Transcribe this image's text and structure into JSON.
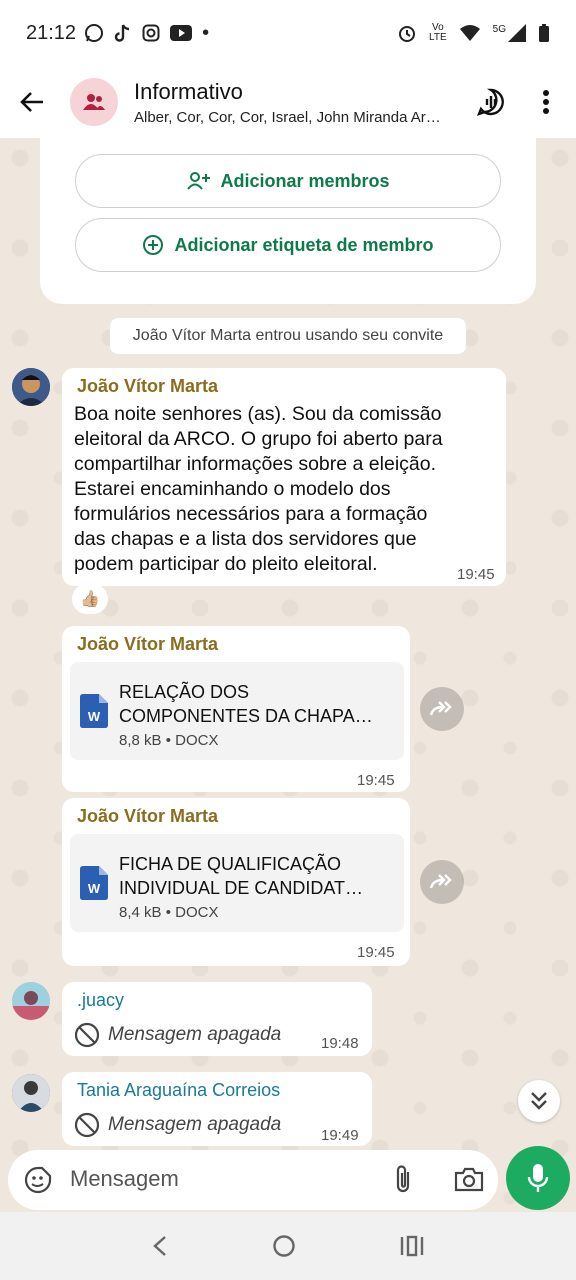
{
  "status_bar": {
    "time": "21:12",
    "network_labels": [
      "Vo",
      "LTE"
    ],
    "signal_label": "5G"
  },
  "header": {
    "title": "Informativo",
    "subtitle": "Alber, Cor, Cor, Cor, Israel, John Miranda Ar…"
  },
  "group_card": {
    "add_members_label": "Adicionar membros",
    "add_tag_label": "Adicionar etiqueta de membro"
  },
  "system_message": "João Vítor Marta entrou usando seu convite",
  "messages": [
    {
      "sender": "João Vítor Marta",
      "lines": [
        "Boa noite senhores (as). Sou da comissão",
        "eleitoral da ARCO. O grupo foi aberto para",
        "compartilhar informações sobre a eleição.",
        "Estarei encaminhando o modelo dos",
        "formulários necessários para a formação",
        "das chapas e a lista dos servidores que",
        "podem participar do pleito eleitoral."
      ],
      "time": "19:45",
      "reaction": "👍🏼"
    },
    {
      "sender": "João Vítor Marta",
      "doc_name_lines": [
        "RELAÇÃO DOS",
        "COMPONENTES DA CHAPA…"
      ],
      "doc_meta": "8,8 kB • DOCX",
      "doc_icon_letter": "W",
      "time": "19:45"
    },
    {
      "sender": "João Vítor Marta",
      "doc_name_lines": [
        "FICHA DE QUALIFICAÇÃO",
        "INDIVIDUAL DE CANDIDAT…"
      ],
      "doc_meta": "8,4 kB • DOCX",
      "doc_icon_letter": "W",
      "time": "19:45"
    },
    {
      "sender": ".juacy",
      "text": "Mensagem apagada",
      "time": "19:48"
    },
    {
      "sender": "Tania Araguaína Correios",
      "text": "Mensagem apagada",
      "time": "19:49"
    }
  ],
  "input": {
    "placeholder": "Mensagem"
  },
  "colors": {
    "accent_green": "#1daa61",
    "sender_brown": "#8a6d1e",
    "sender_teal": "#1a7a9a",
    "word_blue": "#2b5fb3",
    "chat_background": "#efe7dd"
  },
  "icons": [
    "back-arrow-icon",
    "group-icon",
    "voice-chat-icon",
    "more-vert-icon",
    "add-person-icon",
    "add-tag-icon",
    "word-file-icon",
    "forward-icon",
    "deleted-icon",
    "chevrons-down-icon",
    "sticker-icon",
    "attach-icon",
    "camera-icon",
    "mic-icon",
    "nav-back-icon",
    "nav-home-icon",
    "nav-recents-icon"
  ]
}
